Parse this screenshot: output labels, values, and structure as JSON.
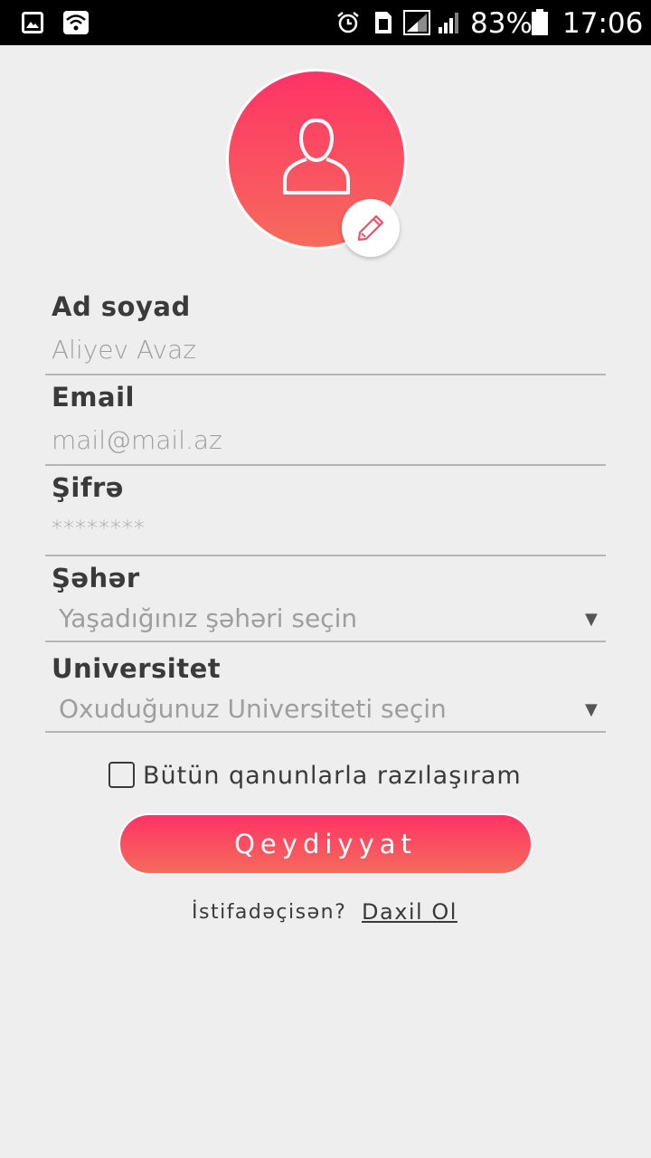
{
  "status_bar": {
    "battery": "83%",
    "time": "17:06",
    "icons": [
      "gallery-icon",
      "wifi-icon",
      "alarm-icon",
      "sim-icon",
      "signal-icon",
      "signal-icon",
      "battery-icon"
    ]
  },
  "avatar": {
    "icon": "user-icon",
    "edit_icon": "pencil-icon",
    "gradient_top": "#ff3366",
    "gradient_bottom": "#f56b5c"
  },
  "form": {
    "fullname": {
      "label": "Ad soyad",
      "value": "Aliyev Avaz"
    },
    "email": {
      "label": "Email",
      "value": "mail@mail.az"
    },
    "password": {
      "label": "Şifrə",
      "value": "********"
    },
    "city": {
      "label": "Şəhər",
      "placeholder": "Yaşadığınız şəhəri seçin"
    },
    "university": {
      "label": "Universitet",
      "placeholder": "Oxuduğunuz Universiteti seçin"
    }
  },
  "agreement": {
    "label": "Bütün qanunlarla razılaşıram",
    "checked": false
  },
  "register_button": {
    "label": "Qeydiyyat"
  },
  "footer": {
    "question": "İstifadəçisən?",
    "login_link": "Daxil Ol"
  },
  "colors": {
    "accent": "#ff3366",
    "background": "#eeeeee",
    "text": "#3a3a3a"
  }
}
